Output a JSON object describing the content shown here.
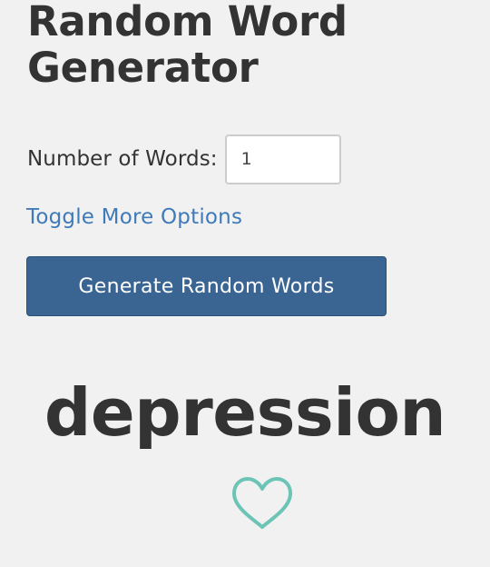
{
  "page": {
    "title": "Random Word Generator"
  },
  "options": {
    "word_count_label": "Number of Words:",
    "word_count_value": "1",
    "toggle_label": "Toggle More Options"
  },
  "actions": {
    "generate_label": "Generate Random Words"
  },
  "result": {
    "word": "depression",
    "favorite_icon": "heart-outline-icon"
  },
  "colors": {
    "background": "#f1f1f1",
    "text": "#333333",
    "link": "#3f7bb8",
    "button": "#3a6593",
    "heart": "#6cc4b6"
  }
}
